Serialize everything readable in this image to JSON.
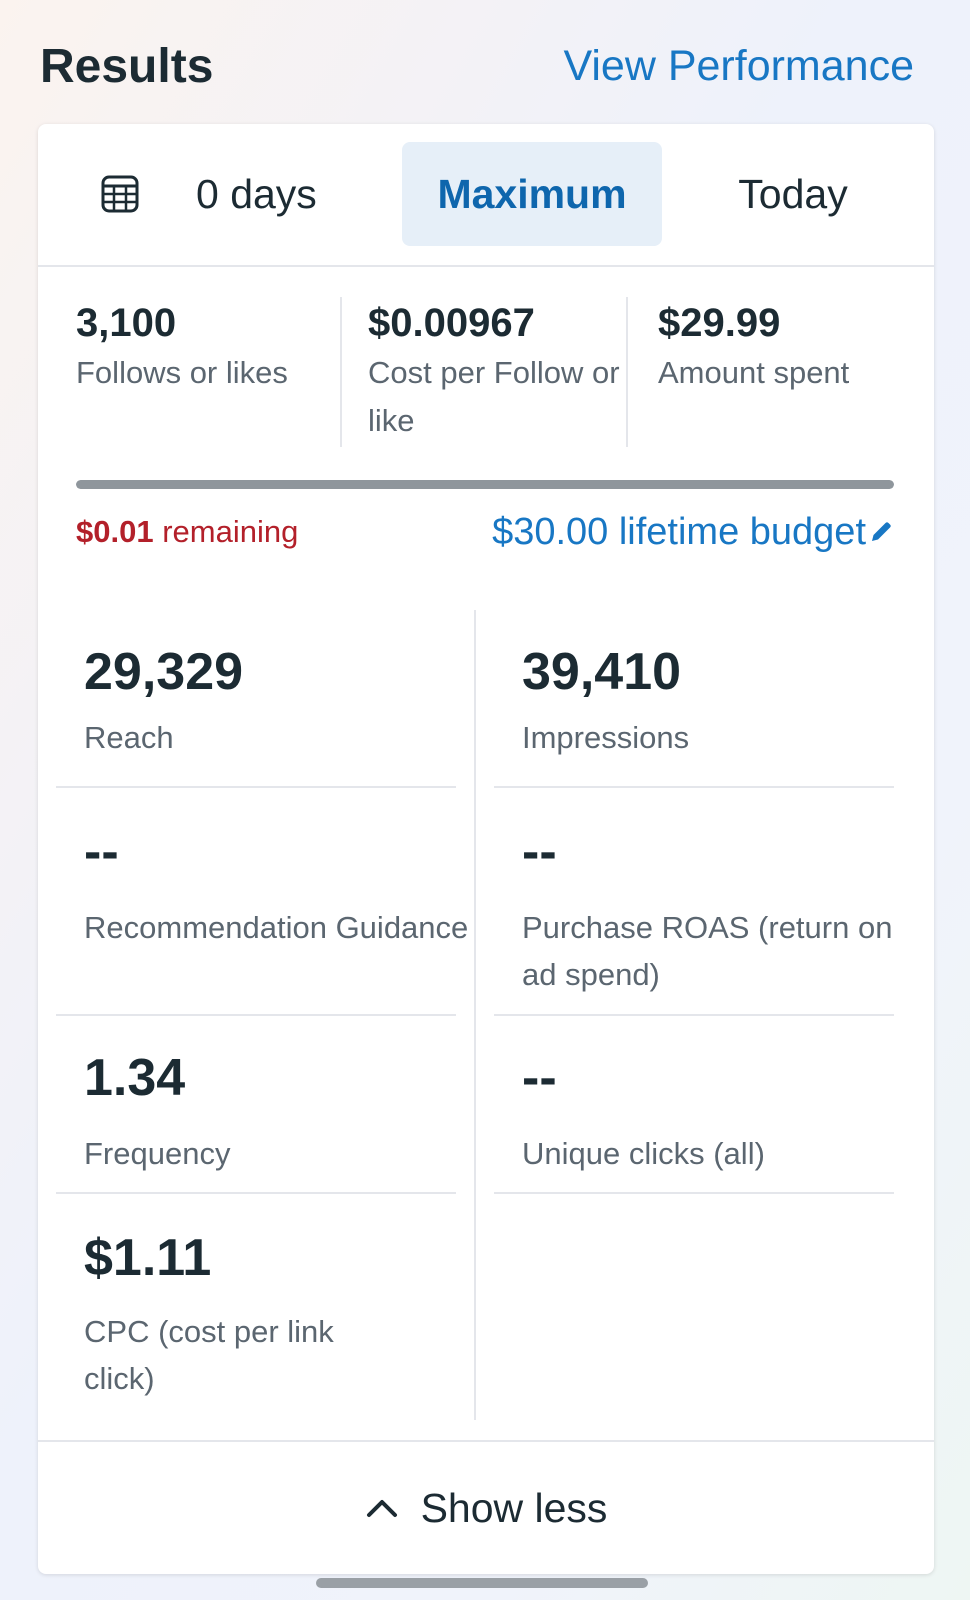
{
  "header": {
    "title": "Results",
    "view_performance": "View Performance"
  },
  "tabs": {
    "days": "0 days",
    "maximum": "Maximum",
    "today": "Today",
    "selected": "Maximum"
  },
  "summary": [
    {
      "value": "3,100",
      "label": "Follows or likes"
    },
    {
      "value": "$0.00967",
      "label": "Cost per Follow or like"
    },
    {
      "value": "$29.99",
      "label": "Amount spent"
    }
  ],
  "budget": {
    "spent_fraction": 0.9997,
    "remaining_amount": "$0.01",
    "remaining_text": "remaining",
    "lifetime": "$30.00 lifetime budget"
  },
  "metrics": [
    {
      "value": "29,329",
      "label": "Reach"
    },
    {
      "value": "39,410",
      "label": "Impressions"
    },
    {
      "value": "--",
      "label": "Recommendation Guidance"
    },
    {
      "value": "--",
      "label": "Purchase ROAS (return on ad spend)"
    },
    {
      "value": "1.34",
      "label": "Frequency"
    },
    {
      "value": "--",
      "label": "Unique clicks (all)"
    },
    {
      "value": "$1.11",
      "label": "CPC (cost per link click)"
    }
  ],
  "footer": {
    "show_less": "Show less"
  },
  "colors": {
    "accent_blue": "#1877c4",
    "remaining_red": "#b3202a",
    "selected_tab_bg": "#e6eff8"
  },
  "icons": {
    "calendar": "calendar-grid-icon",
    "pencil": "pencil-icon",
    "chevron": "chevron-up-icon"
  }
}
